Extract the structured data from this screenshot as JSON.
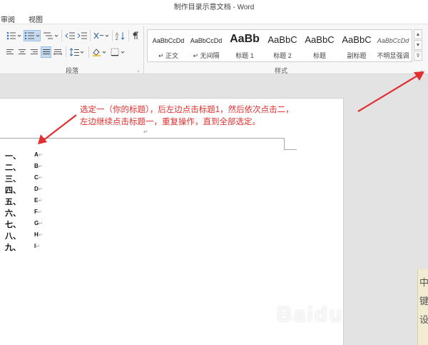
{
  "window": {
    "title": "制作目录示意文档 - Word"
  },
  "tabs": [
    {
      "label": "审阅"
    },
    {
      "label": "视图"
    }
  ],
  "ribbon": {
    "paragraph_group_label": "段落",
    "styles_group_label": "样式",
    "styles": [
      {
        "preview": "AaBbCcDd",
        "name": "↵ 正文"
      },
      {
        "preview": "AaBbCcDd",
        "name": "↵ 无间隔"
      },
      {
        "preview": "AaBb",
        "name": "标题 1"
      },
      {
        "preview": "AaBbC",
        "name": "标题 2"
      },
      {
        "preview": "AaBbC",
        "name": "标题"
      },
      {
        "preview": "AaBbC",
        "name": "副标题"
      },
      {
        "preview": "AaBbCcDd",
        "name": "不明显强调"
      }
    ]
  },
  "annotation": {
    "line1": "选定一（你的标题），后左边点击标题1，然后依次点击二，",
    "line2": "左边继续点击标题一，重复操作，直到全部选定。",
    "color": "#e12f2f"
  },
  "document": {
    "paragraph_mark": "↵",
    "list": [
      {
        "number": "一、",
        "text": "A"
      },
      {
        "number": "二、",
        "text": "B"
      },
      {
        "number": "三、",
        "text": "C"
      },
      {
        "number": "四、",
        "text": "D"
      },
      {
        "number": "五、",
        "text": "E"
      },
      {
        "number": "六、",
        "text": "F"
      },
      {
        "number": "七、",
        "text": "G"
      },
      {
        "number": "八、",
        "text": "H"
      },
      {
        "number": "九、",
        "text": "I"
      }
    ]
  },
  "side_panel": {
    "chars": [
      "中",
      "键",
      "设"
    ]
  },
  "watermark": {
    "text": "Baidu"
  },
  "icons": [
    "bullets-icon",
    "numbering-icon",
    "multilevel-list-icon",
    "decrease-indent-icon",
    "increase-indent-icon",
    "chinese-layout-icon",
    "sort-icon",
    "show-marks-icon",
    "align-left-icon",
    "align-center-icon",
    "align-right-icon",
    "justify-icon",
    "distributed-icon",
    "line-spacing-icon",
    "shading-icon",
    "borders-icon",
    "dialog-launcher-icon",
    "gallery-up-icon",
    "gallery-down-icon",
    "gallery-more-icon"
  ]
}
